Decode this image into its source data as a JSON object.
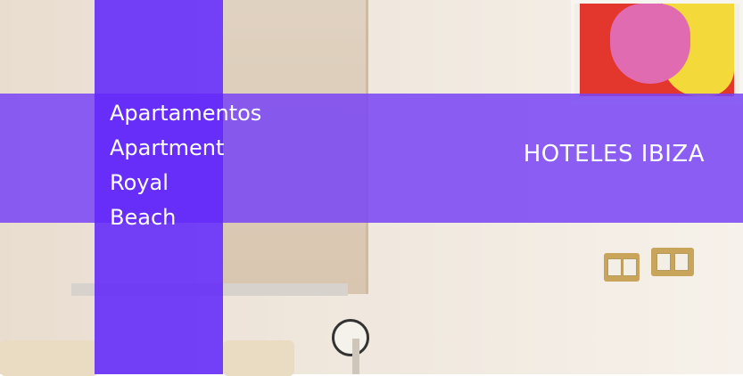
{
  "title_lines": [
    "Apartamentos",
    "Apartment",
    "Royal",
    "Beach"
  ],
  "brand": "HOTELES IBIZA",
  "colors": {
    "band": "#7945f5",
    "column": "#6228fa",
    "text": "#ffffff"
  }
}
